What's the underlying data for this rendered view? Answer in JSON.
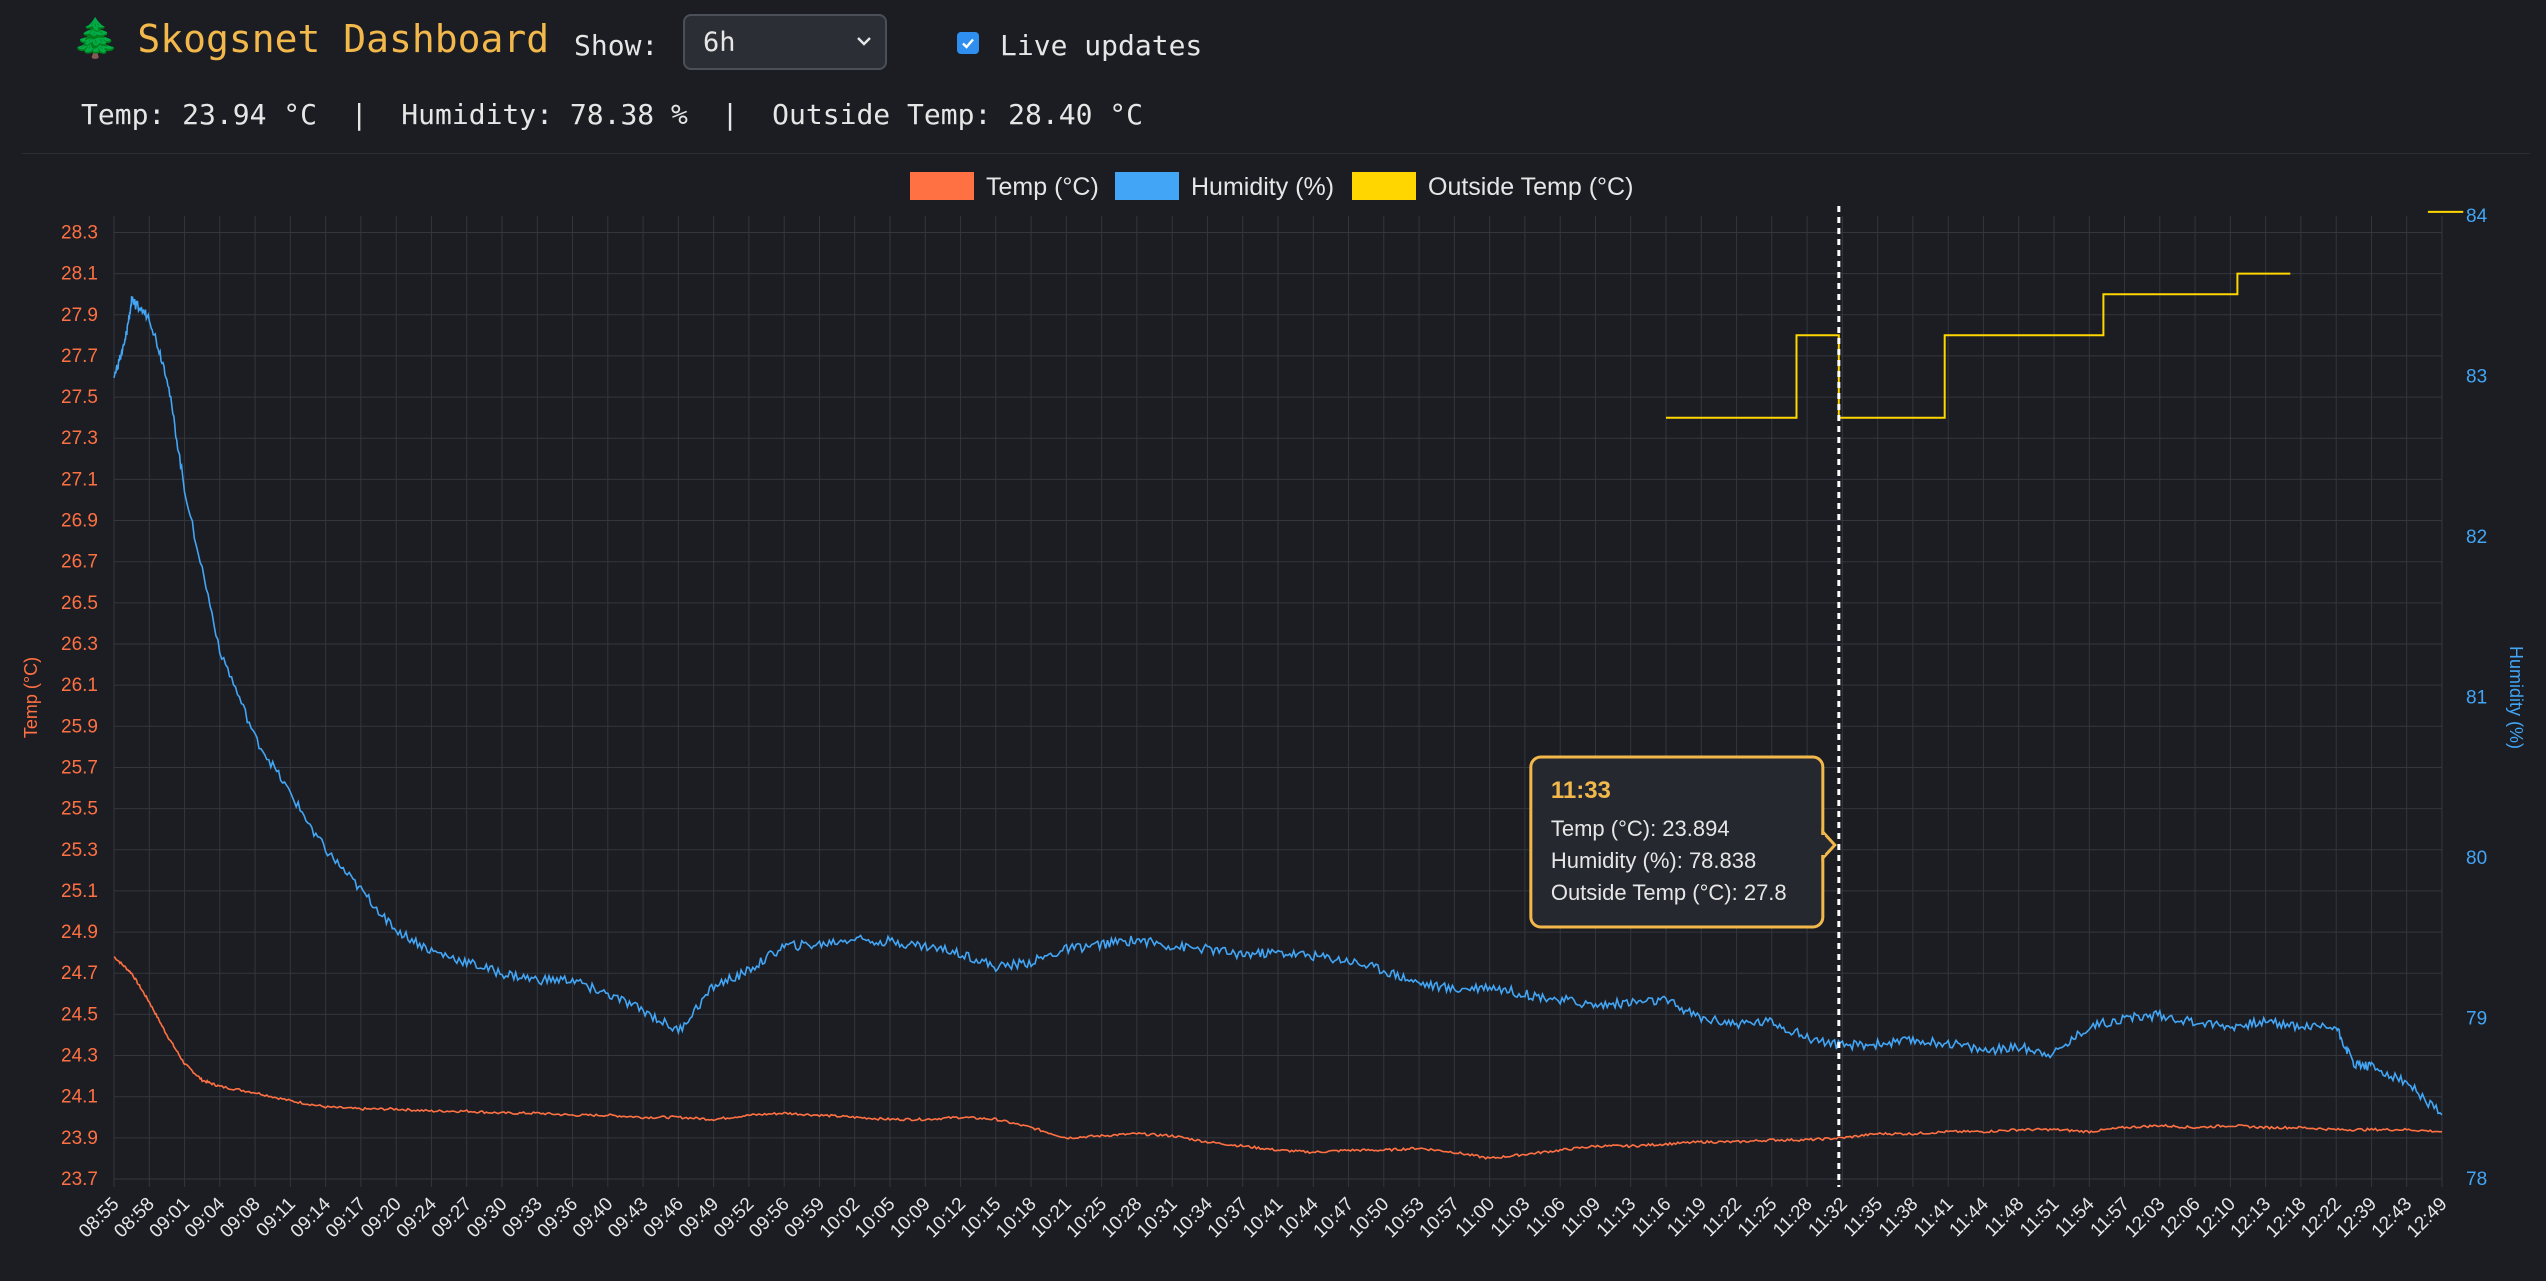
{
  "header": {
    "title": "Skogsnet Dashboard",
    "show_label": "Show:",
    "range_value": "6h",
    "live_label": "Live updates",
    "live_checked": true
  },
  "readout": {
    "text": "Temp: 23.94 °C  |  Humidity: 78.38 %  |  Outside Temp: 28.40 °C"
  },
  "colors": {
    "temp": "#ff7043",
    "humidity": "#42a5f5",
    "outside": "#ffd600",
    "accent": "#f2b84b",
    "grid": "#33363d"
  },
  "chart_data": {
    "type": "line",
    "legend": [
      "Temp (°C)",
      "Humidity (%)",
      "Outside Temp (°C)"
    ],
    "legend_position": "top",
    "y_left_label": "Temp (°C)",
    "y_right_label": "Humidity (%)",
    "y_left_ticks": [
      "23.7",
      "23.9",
      "24.1",
      "24.3",
      "24.5",
      "24.7",
      "24.9",
      "25.1",
      "25.3",
      "25.5",
      "25.7",
      "25.9",
      "26.1",
      "26.3",
      "26.5",
      "26.7",
      "26.9",
      "27.1",
      "27.3",
      "27.5",
      "27.7",
      "27.9",
      "28.1",
      "28.3"
    ],
    "y_left_range": [
      23.7,
      28.38
    ],
    "y_right_ticks": [
      "78",
      "79",
      "80",
      "81",
      "82",
      "83",
      "84"
    ],
    "y_right_range": [
      78,
      84
    ],
    "grid": true,
    "x_ticks": [
      "08:55",
      "08:58",
      "09:01",
      "09:04",
      "09:08",
      "09:11",
      "09:14",
      "09:17",
      "09:20",
      "09:24",
      "09:27",
      "09:30",
      "09:33",
      "09:36",
      "09:40",
      "09:43",
      "09:46",
      "09:49",
      "09:52",
      "09:56",
      "09:59",
      "10:02",
      "10:05",
      "10:09",
      "10:12",
      "10:15",
      "10:18",
      "10:21",
      "10:25",
      "10:28",
      "10:31",
      "10:34",
      "10:37",
      "10:41",
      "10:44",
      "10:47",
      "10:50",
      "10:53",
      "10:57",
      "11:00",
      "11:03",
      "11:06",
      "11:09",
      "11:13",
      "11:16",
      "11:19",
      "11:22",
      "11:25",
      "11:28",
      "11:32",
      "11:35",
      "11:38",
      "11:41",
      "11:44",
      "11:48",
      "11:51",
      "11:54",
      "11:57",
      "12:03",
      "12:06",
      "12:10",
      "12:13",
      "12:18",
      "12:22",
      "12:39",
      "12:43",
      "12:49"
    ],
    "series": [
      {
        "name": "Temp (°C)",
        "axis": "left",
        "points": [
          [
            0,
            24.78
          ],
          [
            0.5,
            24.7
          ],
          [
            1,
            24.56
          ],
          [
            1.5,
            24.4
          ],
          [
            2,
            24.26
          ],
          [
            2.5,
            24.18
          ],
          [
            3,
            24.15
          ],
          [
            4,
            24.12
          ],
          [
            5,
            24.08
          ],
          [
            6,
            24.05
          ],
          [
            7,
            24.04
          ],
          [
            8,
            24.04
          ],
          [
            9,
            24.03
          ],
          [
            10,
            24.03
          ],
          [
            11,
            24.02
          ],
          [
            12,
            24.02
          ],
          [
            13,
            24.01
          ],
          [
            14,
            24.01
          ],
          [
            15,
            24.0
          ],
          [
            16,
            24.0
          ],
          [
            17,
            23.99
          ],
          [
            18,
            24.01
          ],
          [
            19,
            24.02
          ],
          [
            20,
            24.01
          ],
          [
            21,
            24.0
          ],
          [
            22,
            23.99
          ],
          [
            23,
            23.99
          ],
          [
            24,
            24.0
          ],
          [
            25,
            23.99
          ],
          [
            26,
            23.95
          ],
          [
            27,
            23.9
          ],
          [
            28,
            23.91
          ],
          [
            29,
            23.92
          ],
          [
            30,
            23.91
          ],
          [
            31,
            23.88
          ],
          [
            32,
            23.86
          ],
          [
            33,
            23.84
          ],
          [
            34,
            23.83
          ],
          [
            35,
            23.84
          ],
          [
            36,
            23.84
          ],
          [
            37,
            23.85
          ],
          [
            38,
            23.83
          ],
          [
            39,
            23.8
          ],
          [
            40,
            23.82
          ],
          [
            41,
            23.84
          ],
          [
            42,
            23.86
          ],
          [
            43,
            23.86
          ],
          [
            44,
            23.87
          ],
          [
            45,
            23.88
          ],
          [
            46,
            23.88
          ],
          [
            47,
            23.89
          ],
          [
            48,
            23.89
          ],
          [
            49,
            23.9
          ],
          [
            50,
            23.92
          ],
          [
            51,
            23.92
          ],
          [
            52,
            23.93
          ],
          [
            53,
            23.93
          ],
          [
            54,
            23.94
          ],
          [
            55,
            23.94
          ],
          [
            56,
            23.93
          ],
          [
            57,
            23.95
          ],
          [
            58,
            23.96
          ],
          [
            59,
            23.95
          ],
          [
            60,
            23.96
          ],
          [
            61,
            23.95
          ],
          [
            62,
            23.95
          ],
          [
            63,
            23.94
          ],
          [
            64,
            23.94
          ],
          [
            65,
            23.94
          ],
          [
            66,
            23.93
          ]
        ]
      },
      {
        "name": "Humidity (%)",
        "axis": "right",
        "points": [
          [
            0,
            83.0
          ],
          [
            0.3,
            83.2
          ],
          [
            0.5,
            83.47
          ],
          [
            1,
            83.37
          ],
          [
            1.5,
            83.0
          ],
          [
            2,
            82.3
          ],
          [
            3,
            81.3
          ],
          [
            4,
            80.75
          ],
          [
            5,
            80.4
          ],
          [
            6,
            80.05
          ],
          [
            7,
            79.8
          ],
          [
            8,
            79.55
          ],
          [
            9,
            79.42
          ],
          [
            10,
            79.35
          ],
          [
            11,
            79.28
          ],
          [
            12,
            79.24
          ],
          [
            13,
            79.24
          ],
          [
            14,
            79.15
          ],
          [
            15,
            79.05
          ],
          [
            16,
            78.92
          ],
          [
            17,
            79.2
          ],
          [
            18,
            79.3
          ],
          [
            19,
            79.45
          ],
          [
            20,
            79.46
          ],
          [
            21,
            79.5
          ],
          [
            22,
            79.48
          ],
          [
            23,
            79.45
          ],
          [
            24,
            79.41
          ],
          [
            25,
            79.32
          ],
          [
            26,
            79.35
          ],
          [
            27,
            79.43
          ],
          [
            28,
            79.46
          ],
          [
            29,
            79.49
          ],
          [
            30,
            79.45
          ],
          [
            31,
            79.43
          ],
          [
            32,
            79.4
          ],
          [
            33,
            79.41
          ],
          [
            34,
            79.39
          ],
          [
            35,
            79.36
          ],
          [
            36,
            79.3
          ],
          [
            37,
            79.22
          ],
          [
            38,
            79.18
          ],
          [
            39,
            79.2
          ],
          [
            40,
            79.15
          ],
          [
            41,
            79.12
          ],
          [
            42,
            79.08
          ],
          [
            43,
            79.1
          ],
          [
            44,
            79.11
          ],
          [
            45,
            79.0
          ],
          [
            46,
            78.97
          ],
          [
            47,
            78.98
          ],
          [
            48,
            78.88
          ],
          [
            49,
            78.83
          ],
          [
            50,
            78.84
          ],
          [
            51,
            78.86
          ],
          [
            52,
            78.85
          ],
          [
            53,
            78.8
          ],
          [
            54,
            78.82
          ],
          [
            55,
            78.78
          ],
          [
            56,
            78.95
          ],
          [
            57,
            79.0
          ],
          [
            58,
            79.02
          ],
          [
            59,
            78.98
          ],
          [
            60,
            78.95
          ],
          [
            61,
            78.98
          ],
          [
            62,
            78.95
          ],
          [
            63,
            78.95
          ],
          [
            63.5,
            78.72
          ],
          [
            64,
            78.7
          ],
          [
            65,
            78.6
          ],
          [
            66,
            78.4
          ]
        ]
      },
      {
        "name": "Outside Temp (°C)",
        "axis": "left",
        "step": true,
        "segments": [
          {
            "x_from": 44.0,
            "x_to": 47.7,
            "y": 27.4
          },
          {
            "x_from": 47.7,
            "x_to": 48.9,
            "y": 27.8
          },
          {
            "x_from": 48.9,
            "x_to": 51.9,
            "y": 27.4
          },
          {
            "x_from": 51.9,
            "x_to": 56.4,
            "y": 27.8
          },
          {
            "x_from": 56.4,
            "x_to": 60.2,
            "y": 28.0
          },
          {
            "x_from": 60.2,
            "x_to": 61.7,
            "y": 28.1
          },
          {
            "x_from": 65.6,
            "x_to": 66.6,
            "y": 28.4
          }
        ]
      }
    ],
    "hover_x": 48.9,
    "tooltip": {
      "title": "11:33",
      "lines": [
        "Temp (°C): 23.894",
        "Humidity (%): 78.838",
        "Outside Temp (°C): 27.8"
      ]
    }
  }
}
